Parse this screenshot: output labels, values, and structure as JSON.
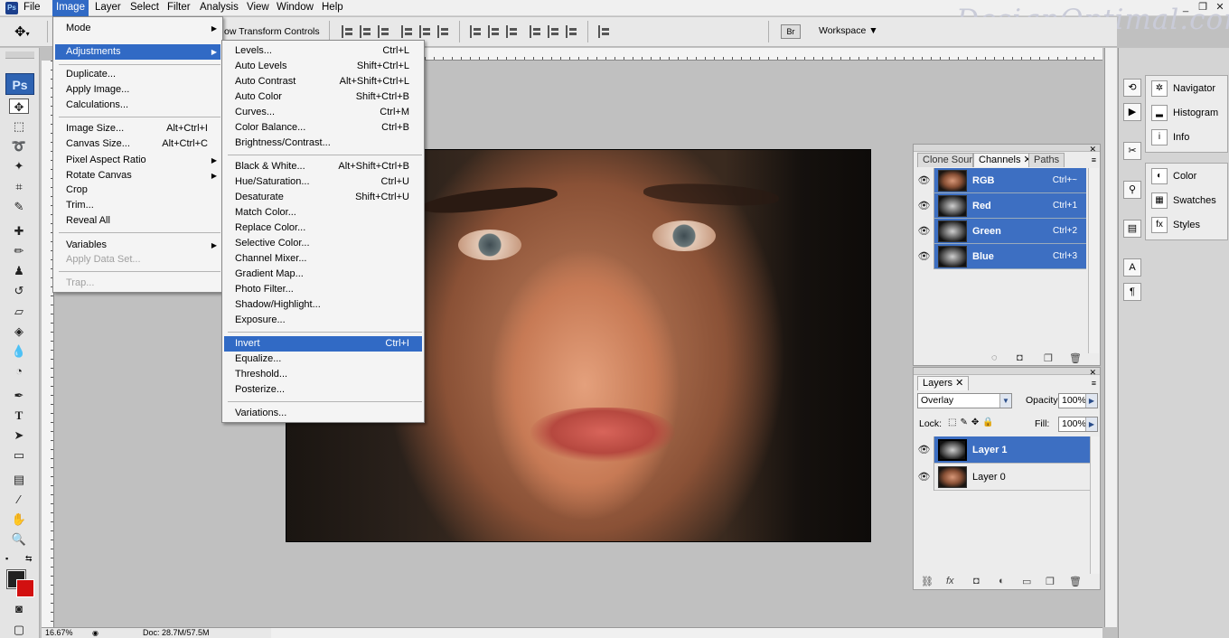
{
  "app": {
    "logo": "Ps"
  },
  "menubar": {
    "items": [
      "File",
      "Image",
      "Layer",
      "Select",
      "Filter",
      "Analysis",
      "View",
      "Window",
      "Help"
    ],
    "active": "Image",
    "win_controls": [
      "_",
      "❐",
      "✕"
    ]
  },
  "watermark": "DesignOptimal.com",
  "options_bar": {
    "transform_label": "ow Transform Controls",
    "workspace_label": "Workspace ▼"
  },
  "image_menu": [
    {
      "label": "Mode",
      "arrow": "▶"
    },
    {
      "label": "Adjustments",
      "arrow": "▶",
      "highlight": true
    },
    {
      "label": "Duplicate..."
    },
    {
      "label": "Apply Image..."
    },
    {
      "label": "Calculations..."
    },
    {
      "label": "Image Size...",
      "shortcut": "Alt+Ctrl+I"
    },
    {
      "label": "Canvas Size...",
      "shortcut": "Alt+Ctrl+C"
    },
    {
      "label": "Pixel Aspect Ratio",
      "arrow": "▶"
    },
    {
      "label": "Rotate Canvas",
      "arrow": "▶"
    },
    {
      "label": "Crop"
    },
    {
      "label": "Trim..."
    },
    {
      "label": "Reveal All"
    },
    {
      "label": "Variables",
      "arrow": "▶"
    },
    {
      "label": "Apply Data Set...",
      "disabled": true
    },
    {
      "label": "Trap...",
      "disabled": true
    }
  ],
  "adjustments_menu": [
    {
      "label": "Levels...",
      "shortcut": "Ctrl+L"
    },
    {
      "label": "Auto Levels",
      "shortcut": "Shift+Ctrl+L"
    },
    {
      "label": "Auto Contrast",
      "shortcut": "Alt+Shift+Ctrl+L"
    },
    {
      "label": "Auto Color",
      "shortcut": "Shift+Ctrl+B"
    },
    {
      "label": "Curves...",
      "shortcut": "Ctrl+M"
    },
    {
      "label": "Color Balance...",
      "shortcut": "Ctrl+B"
    },
    {
      "label": "Brightness/Contrast..."
    },
    {
      "label": "Black & White...",
      "shortcut": "Alt+Shift+Ctrl+B"
    },
    {
      "label": "Hue/Saturation...",
      "shortcut": "Ctrl+U"
    },
    {
      "label": "Desaturate",
      "shortcut": "Shift+Ctrl+U"
    },
    {
      "label": "Match Color..."
    },
    {
      "label": "Replace Color..."
    },
    {
      "label": "Selective Color..."
    },
    {
      "label": "Channel Mixer..."
    },
    {
      "label": "Gradient Map..."
    },
    {
      "label": "Photo Filter..."
    },
    {
      "label": "Shadow/Highlight..."
    },
    {
      "label": "Exposure..."
    },
    {
      "label": "Invert",
      "shortcut": "Ctrl+I",
      "highlight": true
    },
    {
      "label": "Equalize..."
    },
    {
      "label": "Threshold..."
    },
    {
      "label": "Posterize..."
    },
    {
      "label": "Variations..."
    }
  ],
  "dock": {
    "group1": [
      "Navigator",
      "Histogram",
      "Info"
    ],
    "group2": [
      "Color",
      "Swatches",
      "Styles"
    ]
  },
  "channels_panel": {
    "tabs": [
      "Clone Sourc",
      "Channels",
      "Paths"
    ],
    "active_tab": "Channels",
    "rows": [
      {
        "name": "RGB",
        "shortcut": "Ctrl+~"
      },
      {
        "name": "Red",
        "shortcut": "Ctrl+1"
      },
      {
        "name": "Green",
        "shortcut": "Ctrl+2"
      },
      {
        "name": "Blue",
        "shortcut": "Ctrl+3"
      }
    ]
  },
  "layers_panel": {
    "tab": "Layers",
    "blend_mode": "Overlay",
    "opacity_label": "Opacity:",
    "opacity_value": "100%",
    "lock_label": "Lock:",
    "fill_label": "Fill:",
    "fill_value": "100%",
    "layers": [
      {
        "name": "Layer 1",
        "selected": true
      },
      {
        "name": "Layer 0",
        "selected": false
      }
    ]
  },
  "status": {
    "zoom": "16.67%",
    "doc": "Doc: 28.7M/57.5M"
  }
}
